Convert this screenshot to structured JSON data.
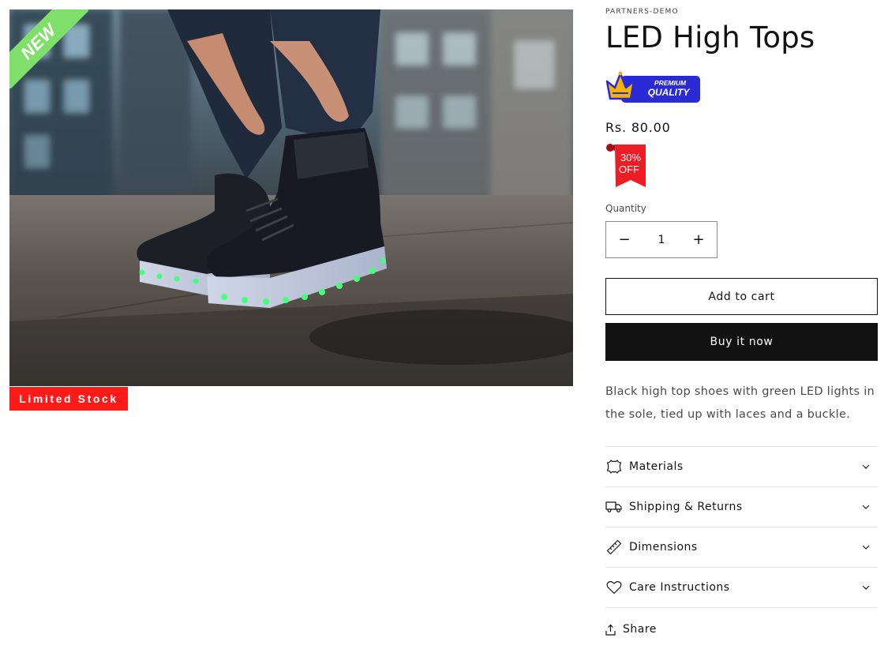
{
  "product": {
    "vendor": "PARTNERS-DEMO",
    "title": "LED High Tops",
    "price": "Rs. 80.00",
    "description": "Black high top shoes with green LED lights in the sole, tied up with laces and a buckle."
  },
  "badges": {
    "new": "NEW",
    "limited_stock": "Limited Stock",
    "premium_line1": "PREMIUM",
    "premium_line2": "QUALITY",
    "discount_line1": "30%",
    "discount_line2": "OFF"
  },
  "quantity": {
    "label": "Quantity",
    "value": "1",
    "decrease_symbol": "−",
    "increase_symbol": "+"
  },
  "buttons": {
    "add_to_cart": "Add to cart",
    "buy_now": "Buy it now"
  },
  "accordion": [
    {
      "label": "Materials",
      "icon": "leather-icon"
    },
    {
      "label": "Shipping & Returns",
      "icon": "truck-icon"
    },
    {
      "label": "Dimensions",
      "icon": "ruler-icon"
    },
    {
      "label": "Care Instructions",
      "icon": "heart-icon"
    }
  ],
  "share": {
    "label": "Share",
    "icon": "share-icon"
  },
  "colors": {
    "new_ribbon": "#7ee06a",
    "limited_stock_bg": "#ff1a1a",
    "premium_blue": "#2b2bd6",
    "crown_gold": "#f5b301",
    "discount_red": "#ee1c25",
    "buy_now_bg": "#121212"
  }
}
